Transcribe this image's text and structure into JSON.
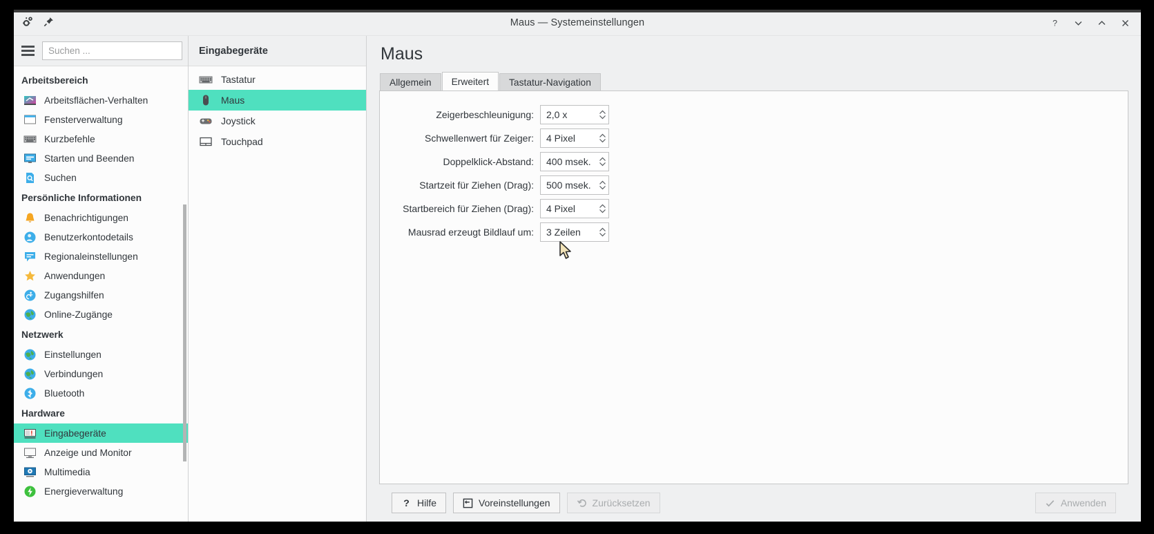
{
  "window": {
    "title": "Maus — Systemeinstellungen",
    "titlebar_icons": [
      "configure-icon",
      "pin-icon"
    ],
    "controls": [
      {
        "name": "help-button",
        "glyph": "?"
      },
      {
        "name": "minimize-button",
        "glyph": "⌄"
      },
      {
        "name": "maximize-button",
        "glyph": "⌃"
      },
      {
        "name": "close-button",
        "glyph": "✕"
      }
    ],
    "accent_color": "#4fe0bf",
    "background_color": "#eff0f1"
  },
  "sidebar": {
    "menu_icon": "hamburger-icon",
    "search": {
      "placeholder": "Suchen ...",
      "value": ""
    },
    "groups": [
      {
        "label": "Arbeitsbereich",
        "items": [
          {
            "label": "Arbeitsflächen-Verhalten",
            "icon": "desktop-behavior-icon",
            "selected": false
          },
          {
            "label": "Fensterverwaltung",
            "icon": "window-management-icon",
            "selected": false
          },
          {
            "label": "Kurzbefehle",
            "icon": "keyboard-shortcuts-icon",
            "selected": false
          },
          {
            "label": "Starten und Beenden",
            "icon": "startup-shutdown-icon",
            "selected": false
          },
          {
            "label": "Suchen",
            "icon": "search-document-icon",
            "selected": false
          }
        ]
      },
      {
        "label": "Persönliche Informationen",
        "items": [
          {
            "label": "Benachrichtigungen",
            "icon": "bell-icon",
            "selected": false
          },
          {
            "label": "Benutzerkontodetails",
            "icon": "user-account-icon",
            "selected": false
          },
          {
            "label": "Regionaleinstellungen",
            "icon": "region-language-icon",
            "selected": false
          },
          {
            "label": "Anwendungen",
            "icon": "star-icon",
            "selected": false
          },
          {
            "label": "Zugangshilfen",
            "icon": "accessibility-icon",
            "selected": false
          },
          {
            "label": "Online-Zugänge",
            "icon": "globe-icon",
            "selected": false
          }
        ]
      },
      {
        "label": "Netzwerk",
        "items": [
          {
            "label": "Einstellungen",
            "icon": "globe-icon",
            "selected": false
          },
          {
            "label": "Verbindungen",
            "icon": "globe-icon",
            "selected": false
          },
          {
            "label": "Bluetooth",
            "icon": "bluetooth-icon",
            "selected": false
          }
        ]
      },
      {
        "label": "Hardware",
        "items": [
          {
            "label": "Eingabegeräte",
            "icon": "input-devices-icon",
            "selected": true
          },
          {
            "label": "Anzeige und Monitor",
            "icon": "display-monitor-icon",
            "selected": false
          },
          {
            "label": "Multimedia",
            "icon": "multimedia-icon",
            "selected": false
          },
          {
            "label": "Energieverwaltung",
            "icon": "power-management-icon",
            "selected": false
          }
        ]
      }
    ]
  },
  "modulelist": {
    "header": "Eingabegeräte",
    "items": [
      {
        "label": "Tastatur",
        "icon": "keyboard-icon",
        "selected": false
      },
      {
        "label": "Maus",
        "icon": "mouse-icon",
        "selected": true
      },
      {
        "label": "Joystick",
        "icon": "joystick-icon",
        "selected": false
      },
      {
        "label": "Touchpad",
        "icon": "touchpad-icon",
        "selected": false
      }
    ]
  },
  "main": {
    "title": "Maus",
    "tabs": [
      {
        "label": "Allgemein",
        "active": false
      },
      {
        "label": "Erweitert",
        "active": true
      },
      {
        "label": "Tastatur-Navigation",
        "active": false
      }
    ],
    "fields": [
      {
        "label": "Zeigerbeschleunigung:",
        "value": "2,0 x",
        "name": "pointer-acceleration-spinbox"
      },
      {
        "label": "Schwellenwert für Zeiger:",
        "value": "4 Pixel",
        "name": "pointer-threshold-spinbox"
      },
      {
        "label": "Doppelklick-Abstand:",
        "value": "400 msek.",
        "name": "double-click-interval-spinbox"
      },
      {
        "label": "Startzeit für Ziehen (Drag):",
        "value": "500 msek.",
        "name": "drag-start-time-spinbox"
      },
      {
        "label": "Startbereich für Ziehen (Drag):",
        "value": "4 Pixel",
        "name": "drag-start-distance-spinbox"
      },
      {
        "label": "Mausrad erzeugt Bildlauf um:",
        "value": "3 Zeilen",
        "name": "wheel-scroll-lines-spinbox"
      }
    ]
  },
  "footer": {
    "help_label": "Hilfe",
    "defaults_label": "Voreinstellungen",
    "reset_label": "Zurücksetzen",
    "apply_label": "Anwenden",
    "reset_disabled": true,
    "apply_disabled": true
  }
}
